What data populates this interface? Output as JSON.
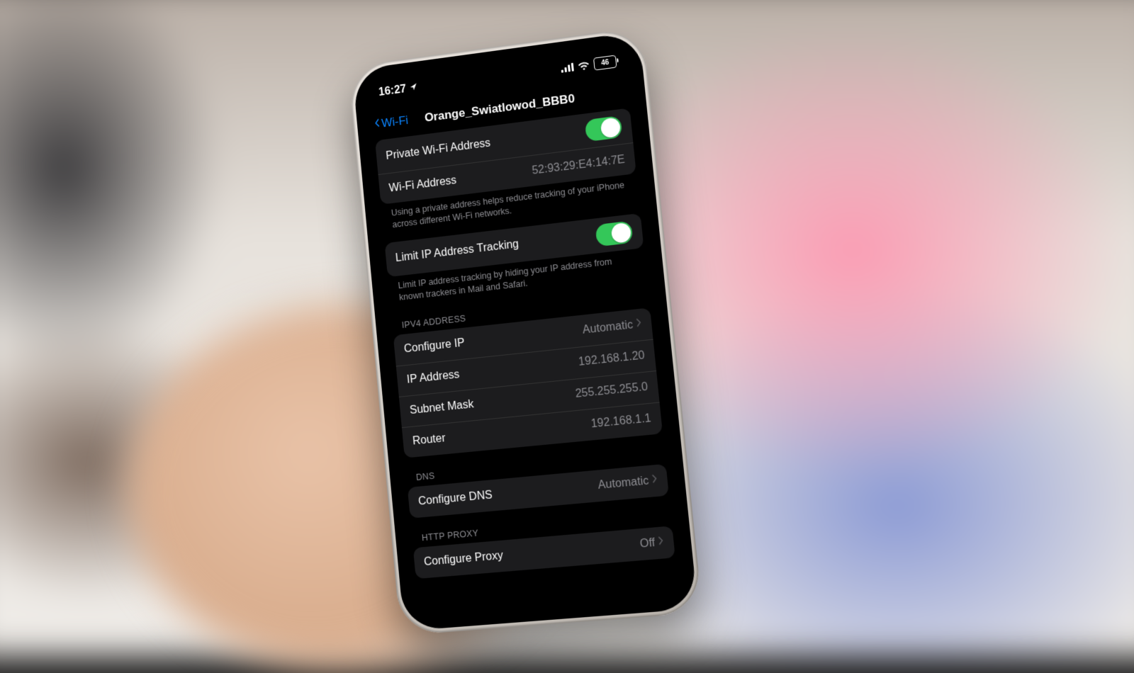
{
  "status": {
    "time": "16:27",
    "battery": "46"
  },
  "nav": {
    "back": "Wi-Fi",
    "title": "Orange_Swiatlowod_BBB0"
  },
  "private_wifi": {
    "label": "Private Wi-Fi Address"
  },
  "wifi_address": {
    "label": "Wi-Fi Address",
    "value": "52:93:29:E4:14:7E"
  },
  "footer_private": "Using a private address helps reduce tracking of your iPhone across different Wi-Fi networks.",
  "limit_ip": {
    "label": "Limit IP Address Tracking"
  },
  "footer_limit": "Limit IP address tracking by hiding your IP address from known trackers in Mail and Safari.",
  "ipv4": {
    "header": "IPV4 Address",
    "configure_label": "Configure IP",
    "configure_value": "Automatic",
    "ip_label": "IP Address",
    "ip_value": "192.168.1.20",
    "subnet_label": "Subnet Mask",
    "subnet_value": "255.255.255.0",
    "router_label": "Router",
    "router_value": "192.168.1.1"
  },
  "dns": {
    "header": "DNS",
    "configure_label": "Configure DNS",
    "configure_value": "Automatic"
  },
  "proxy": {
    "header": "HTTP Proxy",
    "configure_label": "Configure Proxy",
    "configure_value": "Off"
  }
}
